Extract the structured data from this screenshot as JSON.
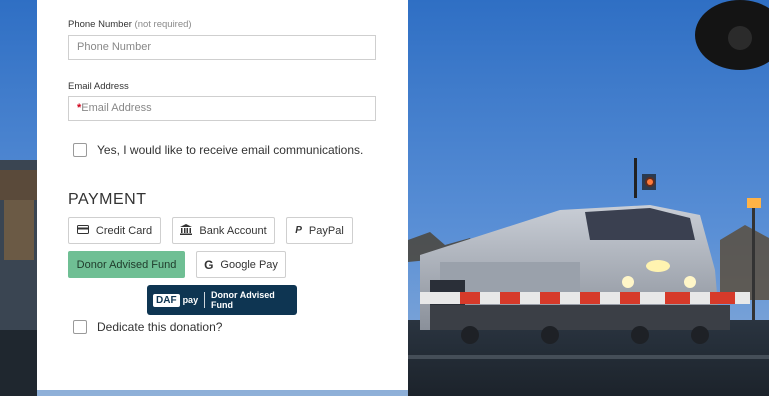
{
  "form": {
    "phone": {
      "label": "Phone Number",
      "label_note": "(not required)",
      "placeholder": "Phone Number"
    },
    "email": {
      "label": "Email Address",
      "required_mark": "*",
      "placeholder": "Email Address"
    },
    "email_opt_in": {
      "label": "Yes, I would like to receive email communications.",
      "checked": false
    },
    "payment": {
      "heading": "PAYMENT",
      "methods": [
        {
          "label": "Credit Card",
          "icon": "credit-card-icon",
          "active": false
        },
        {
          "label": "Bank Account",
          "icon": "bank-icon",
          "active": false
        },
        {
          "label": "PayPal",
          "icon": "paypal-icon",
          "active": false
        },
        {
          "label": "Donor Advised Fund",
          "icon": "",
          "active": true
        },
        {
          "label": "Google Pay",
          "icon": "google-g-icon",
          "active": false
        }
      ],
      "daf_pay": {
        "logo": "DAF",
        "pay": "pay",
        "text": "Donor Advised Fund"
      }
    },
    "dedicate": {
      "label": "Dedicate this donation?",
      "checked": false
    }
  },
  "colors": {
    "accent_green": "#6fbf94",
    "daf_navy": "#0e3552",
    "required_red": "#d0021b"
  }
}
